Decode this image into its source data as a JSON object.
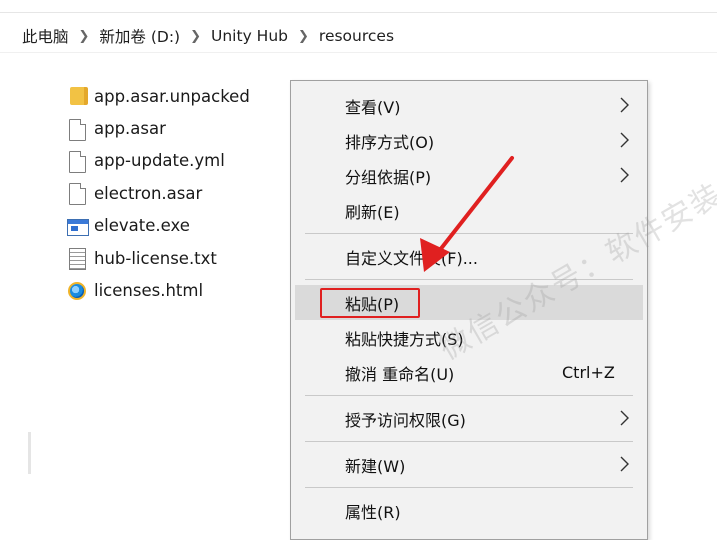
{
  "address_bar": {
    "breadcrumbs": [
      "此电脑",
      "新加卷 (D:)",
      "Unity Hub",
      "resources"
    ]
  },
  "files": [
    {
      "name": "app.asar.unpacked",
      "icon": "folder-icon"
    },
    {
      "name": "app.asar",
      "icon": "file-icon"
    },
    {
      "name": "app-update.yml",
      "icon": "file-icon"
    },
    {
      "name": "electron.asar",
      "icon": "file-icon"
    },
    {
      "name": "elevate.exe",
      "icon": "exe-icon"
    },
    {
      "name": "hub-license.txt",
      "icon": "text-file-icon"
    },
    {
      "name": "licenses.html",
      "icon": "browser-html-icon"
    }
  ],
  "context_menu": {
    "items": {
      "view": {
        "label": "查看(V)",
        "has_submenu": true
      },
      "sort": {
        "label": "排序方式(O)",
        "has_submenu": true
      },
      "group": {
        "label": "分组依据(P)",
        "has_submenu": true
      },
      "refresh": {
        "label": "刷新(E)"
      },
      "customize": {
        "label": "自定义文件夹(F)..."
      },
      "paste": {
        "label": "粘贴(P)",
        "highlighted": true
      },
      "paste_shortcut": {
        "label": "粘贴快捷方式(S)"
      },
      "undo_rename": {
        "label": "撤消 重命名(U)",
        "shortcut": "Ctrl+Z"
      },
      "give_access": {
        "label": "授予访问权限(G)",
        "has_submenu": true
      },
      "new": {
        "label": "新建(W)",
        "has_submenu": true
      },
      "properties": {
        "label": "属性(R)"
      }
    }
  },
  "watermark": {
    "text": "微信公众号：软件安装"
  },
  "colors": {
    "highlight_box": "#e02020",
    "arrow": "#e02020",
    "menu_bg": "#f2f2f2",
    "menu_hover": "#dadada"
  }
}
